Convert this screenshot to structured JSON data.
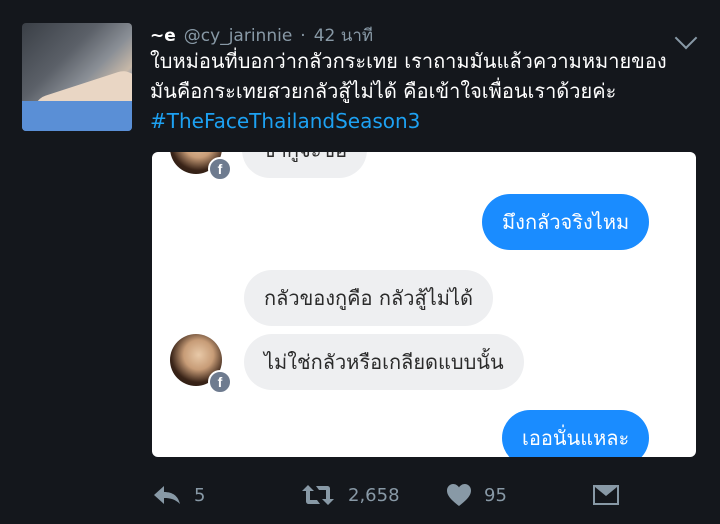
{
  "tweet": {
    "display_name": "~e",
    "handle": "@cy_jarinnie",
    "separator": "·",
    "timestamp": "42 นาที",
    "text_line1": "ใบหม่อนที่บอกว่ากลัวกระเทย เราถามมันแล้วความหมายของ",
    "text_line2": "มันคือกระเทยสวยกลัวสู้ไม่ได้ คือเข้าใจเพื่อนเราด้วยค่ะ",
    "hashtag": "#TheFaceThailandSeason3"
  },
  "chat": {
    "msg_partial": "ข้ากูจะขอ",
    "msg1": "มึงกลัวจริงไหม",
    "msg2": "กลัวของกูคือ กลัวสู้ไม่ได้",
    "msg3": "ไม่ใช่กลัวหรือเกลียดแบบนั้น",
    "msg4": "เออนั่นแหละ",
    "badge_letter": "f"
  },
  "actions": {
    "reply_count": "5",
    "retweet_count": "2,658",
    "like_count": "95"
  },
  "icons": [
    "reply-icon",
    "retweet-icon",
    "like-icon",
    "direct-message-icon",
    "chevron-down-icon",
    "facebook-icon"
  ],
  "colors": {
    "background": "#14171c",
    "hashtag": "#1da1f2",
    "muted": "#8899a6",
    "chat_blue": "#1a8cff",
    "chat_gray": "#eeeff1"
  }
}
